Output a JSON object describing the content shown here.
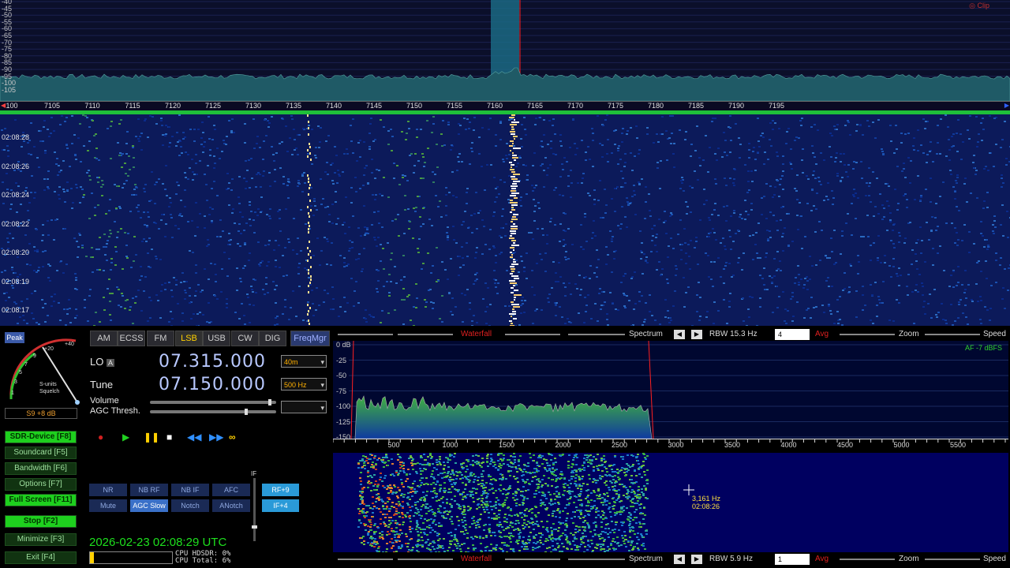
{
  "spectrum": {
    "db_ticks": [
      "-40",
      "-45",
      "-50",
      "-55",
      "-60",
      "-65",
      "-70",
      "-75",
      "-80",
      "-85",
      "-90",
      "-95",
      "-100",
      "-105"
    ],
    "clip_label": "Clip",
    "freq_ticks": [
      "7100",
      "7105",
      "7110",
      "7115",
      "7120",
      "7125",
      "7130",
      "7135",
      "7140",
      "7145",
      "7150",
      "7155",
      "7160",
      "7165",
      "7170",
      "7175",
      "7180",
      "7185",
      "7190",
      "7195"
    ],
    "ruler_first": "100"
  },
  "waterfall": {
    "timestamps": [
      "02:08:28",
      "02:08:26",
      "02:08:24",
      "02:08:22",
      "02:08:20",
      "02:08:19",
      "02:08:17"
    ]
  },
  "smeter": {
    "peak_label": "Peak",
    "scale": [
      "1",
      "3",
      "5",
      "7",
      "9",
      "+20",
      "+40"
    ],
    "caption1": "S-units",
    "caption2": "Squelch",
    "reading": "S9 +8 dB"
  },
  "modes": [
    {
      "label": "AM",
      "selected": false
    },
    {
      "label": "ECSS",
      "selected": false
    },
    {
      "label": "FM",
      "selected": false
    },
    {
      "label": "LSB",
      "selected": true
    },
    {
      "label": "USB",
      "selected": false
    },
    {
      "label": "CW",
      "selected": false
    },
    {
      "label": "DIG",
      "selected": false
    }
  ],
  "freqmgr_label": "FreqMgr",
  "lo": {
    "label": "LO",
    "tag": "A",
    "value": "07.315.000",
    "band": "40m"
  },
  "tune": {
    "label": "Tune",
    "value": "07.150.000",
    "step": "500 Hz"
  },
  "volume_label": "Volume",
  "agc_label": "AGC Thresh.",
  "side_buttons": [
    {
      "label": "SDR-Device [F8]",
      "on": true
    },
    {
      "label": "Soundcard [F5]",
      "on": false
    },
    {
      "label": "Bandwidth [F6]",
      "on": false
    },
    {
      "label": "Options [F7]",
      "on": false
    },
    {
      "label": "Full Screen [F11]",
      "on": true
    },
    {
      "label": "Stop [F2]",
      "on": true
    },
    {
      "label": "Minimize [F3]",
      "on": false
    },
    {
      "label": "Exit [F4]",
      "on": false
    }
  ],
  "filters_row1": [
    {
      "label": "NR",
      "on": false
    },
    {
      "label": "NB RF",
      "on": false
    },
    {
      "label": "NB IF",
      "on": false
    },
    {
      "label": "AFC",
      "on": false
    }
  ],
  "filters_row2": [
    {
      "label": "Mute",
      "on": false
    },
    {
      "label": "AGC Slow",
      "on": true
    },
    {
      "label": "Notch",
      "on": false
    },
    {
      "label": "ANotch",
      "on": false
    }
  ],
  "rf_gain": "RF+9",
  "if_gain": "IF+4",
  "if_label": "IF",
  "datetime": "2026-02-23   02:08:29 UTC",
  "cpu": {
    "hdsdr": "CPU HDSDR:  0%",
    "total": "CPU Total:  6%"
  },
  "toolbar_top": {
    "waterfall": "Waterfall",
    "spectrum": "Spectrum",
    "rbw": "RBW 15.3 Hz",
    "avg_val": "4",
    "avg": "Avg",
    "zoom": "Zoom",
    "speed": "Speed"
  },
  "toolbar_bottom": {
    "waterfall": "Waterfall",
    "spectrum": "Spectrum",
    "rbw": "RBW  5.9 Hz",
    "avg_val": "1",
    "avg": "Avg",
    "zoom": "Zoom",
    "speed": "Speed"
  },
  "af_spectrum": {
    "db_ticks": [
      "0 dB",
      "-25",
      "-50",
      "-75",
      "-100",
      "-125",
      "-150"
    ],
    "af_label": "AF  -7 dBFS",
    "freq_ticks": [
      "500",
      "1000",
      "1500",
      "2000",
      "2500",
      "3000",
      "3500",
      "4000",
      "4500",
      "5000",
      "5500"
    ]
  },
  "cursor": {
    "freq": "3,161 Hz",
    "time": "02:08:26"
  },
  "colors": {
    "accent": "#1ed01e",
    "freq_display": "#b8c8ff",
    "waterfall_label": "#e02020"
  }
}
